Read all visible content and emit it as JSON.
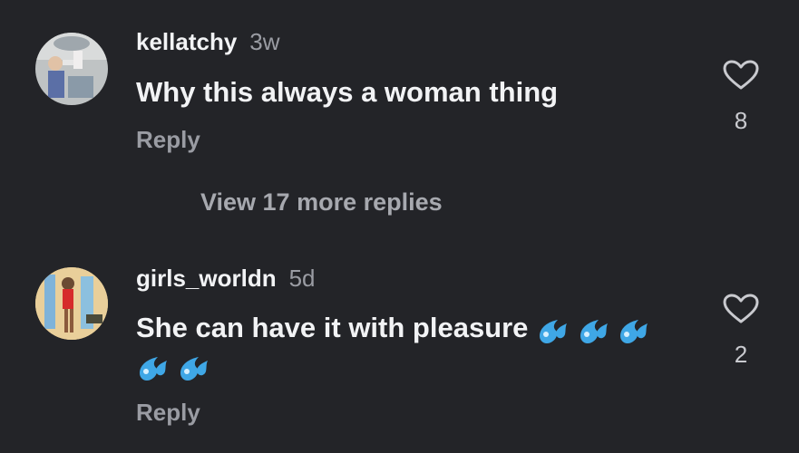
{
  "comments": [
    {
      "author": "kellatchy",
      "time": "3w",
      "text": "Why this always  a woman thing",
      "reply_label": "Reply",
      "likes": "8",
      "view_more": "View 17 more replies"
    },
    {
      "author": "girls_worldn",
      "time": "5d",
      "text": "She can have it with pleasure",
      "reply_label": "Reply",
      "likes": "2"
    }
  ],
  "icons": {
    "like": "heart-outline-icon",
    "emoji": "sweat-droplets-emoji"
  },
  "colors": {
    "background": "#232428",
    "primary_text": "#f2f3f5",
    "secondary_text": "#9a9ca3",
    "emoji_blue": "#3fa7e6"
  }
}
